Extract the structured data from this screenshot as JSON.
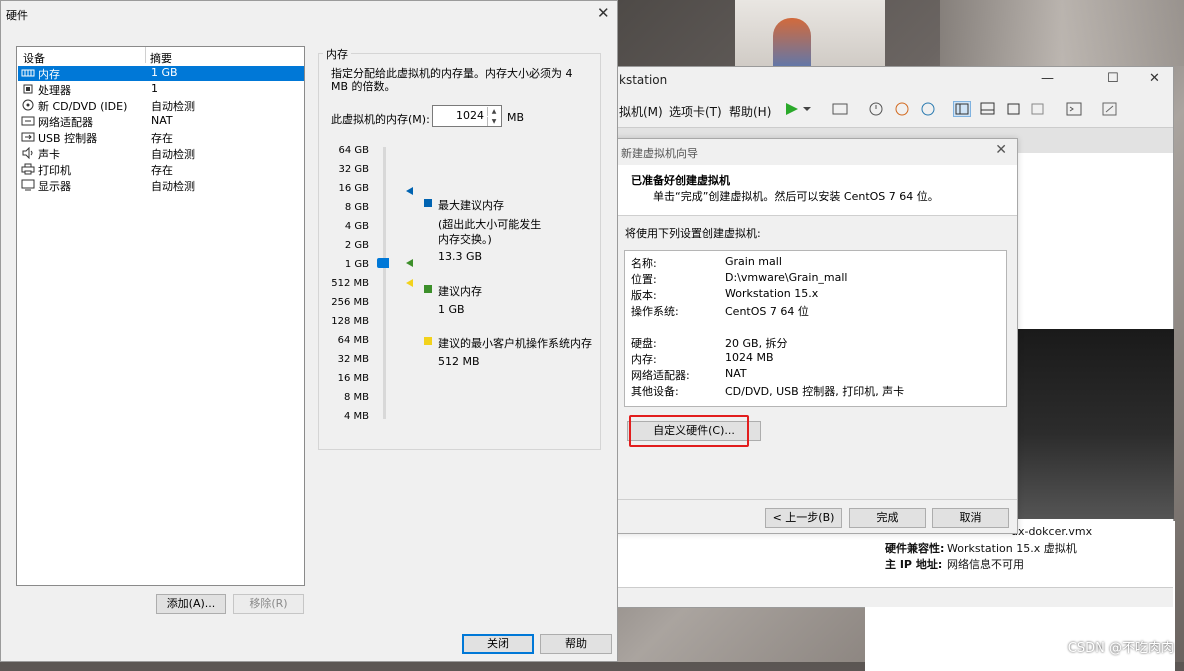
{
  "workstation": {
    "title_fragment": "kstation",
    "menus": [
      "拟机(M)",
      "选项卡(T)",
      "帮助(H)"
    ],
    "info": [
      {
        "k": "",
        "v": "ux-dokcer.vmx"
      },
      {
        "k": "硬件兼容性:",
        "v": "Workstation 15.x 虚拟机"
      },
      {
        "k": "主 IP 地址:",
        "v": "网络信息不可用"
      }
    ]
  },
  "watermark": "CSDN @不吃肉肉",
  "wizard": {
    "title": "新建虚拟机向导",
    "heading": "已准备好创建虚拟机",
    "subheading": "单击“完成”创建虚拟机。然后可以安装 CentOS 7 64 位。",
    "settings_label": "将使用下列设置创建虚拟机:",
    "settings": [
      {
        "k": "名称:",
        "v": "Grain mall"
      },
      {
        "k": "位置:",
        "v": "D:\\vmware\\Grain_mall"
      },
      {
        "k": "版本:",
        "v": "Workstation 15.x"
      },
      {
        "k": "操作系统:",
        "v": "CentOS 7 64 位"
      },
      {
        "k": "硬盘:",
        "v": "20 GB, 拆分"
      },
      {
        "k": "内存:",
        "v": "1024 MB"
      },
      {
        "k": "网络适配器:",
        "v": "NAT"
      },
      {
        "k": "其他设备:",
        "v": "CD/DVD, USB 控制器, 打印机, 声卡"
      }
    ],
    "customize_button": "自定义硬件(C)...",
    "back_button": "< 上一步(B)",
    "finish_button": "完成",
    "cancel_button": "取消"
  },
  "hardware": {
    "title": "硬件",
    "col_device": "设备",
    "col_summary": "摘要",
    "devices": [
      {
        "name": "内存",
        "summary": "1 GB",
        "icon": "memory-icon",
        "selected": true
      },
      {
        "name": "处理器",
        "summary": "1",
        "icon": "cpu-icon",
        "selected": false
      },
      {
        "name": "新 CD/DVD (IDE)",
        "summary": "自动检测",
        "icon": "cd-icon",
        "selected": false
      },
      {
        "name": "网络适配器",
        "summary": "NAT",
        "icon": "network-icon",
        "selected": false
      },
      {
        "name": "USB 控制器",
        "summary": "存在",
        "icon": "usb-icon",
        "selected": false
      },
      {
        "name": "声卡",
        "summary": "自动检测",
        "icon": "sound-icon",
        "selected": false
      },
      {
        "name": "打印机",
        "summary": "存在",
        "icon": "printer-icon",
        "selected": false
      },
      {
        "name": "显示器",
        "summary": "自动检测",
        "icon": "display-icon",
        "selected": false
      }
    ],
    "add_button": "添加(A)...",
    "remove_button": "移除(R)",
    "close_button": "关闭",
    "help_button": "帮助",
    "memory": {
      "group_title": "内存",
      "description": "指定分配给此虚拟机的内存量。内存大小必须为 4 MB 的倍数。",
      "label": "此虚拟机的内存(M):",
      "value": "1024",
      "unit": "MB",
      "ticks": [
        "64 GB",
        "32 GB",
        "16 GB",
        "8 GB",
        "4 GB",
        "2 GB",
        "1 GB",
        "512 MB",
        "256 MB",
        "128 MB",
        "64 MB",
        "32 MB",
        "16 MB",
        "8 MB",
        "4 MB"
      ],
      "legend": [
        {
          "title": "最大建议内存",
          "note": "(超出此大小可能发生内存交换。)",
          "value": "13.3 GB",
          "color": "#0063b1"
        },
        {
          "title": "建议内存",
          "note": "",
          "value": "1 GB",
          "color": "#3c8f2a"
        },
        {
          "title": "建议的最小客户机操作系统内存",
          "note": "",
          "value": "512 MB",
          "color": "#f2d21b"
        }
      ]
    }
  }
}
